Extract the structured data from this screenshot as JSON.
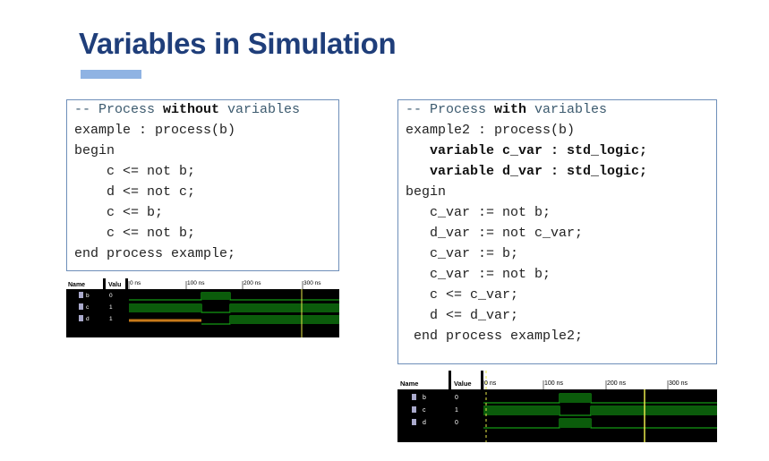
{
  "slide": {
    "title": "Variables in Simulation"
  },
  "left_code": {
    "lines": [
      {
        "pre": "-- Process ",
        "kw": "without",
        "post": " variables",
        "comment": true
      },
      {
        "text": "example : process(b)"
      },
      {
        "text": "begin"
      },
      {
        "text": "    c <= not b;"
      },
      {
        "text": "    d <= not c;"
      },
      {
        "text": "    c <= b;"
      },
      {
        "text": "    c <= not b;"
      },
      {
        "text": "end process example;"
      }
    ]
  },
  "right_code": {
    "lines": [
      {
        "pre": "-- Process ",
        "kw": "with",
        "post": " variables",
        "comment": true
      },
      {
        "text": "example2 : process(b)"
      },
      {
        "text": "   variable c_var : std_logic;",
        "bold": true
      },
      {
        "text": "   variable d_var : std_logic;",
        "bold": true
      },
      {
        "text": "begin"
      },
      {
        "text": "   c_var := not b;"
      },
      {
        "text": "   d_var := not c_var;"
      },
      {
        "text": "   c_var := b;"
      },
      {
        "text": "   c_var := not b;"
      },
      {
        "text": "   c <= c_var;"
      },
      {
        "text": "   d <= d_var;"
      },
      {
        "text": " end process example2;"
      }
    ]
  },
  "wave_left": {
    "headers": {
      "name": "Name",
      "value": "Valu"
    },
    "ticks": [
      "0 ns",
      "100 ns",
      "200 ns",
      "300 ns"
    ],
    "signals": [
      {
        "name": "b",
        "value": "0"
      },
      {
        "name": "c",
        "value": "1"
      },
      {
        "name": "d",
        "value": "1"
      }
    ],
    "colors": {
      "signal": "#18c018",
      "unknown": "#c87a1a",
      "cursor": "#e8e84a"
    }
  },
  "wave_right": {
    "headers": {
      "name": "Name",
      "value": "Value"
    },
    "ticks": [
      "0 ns",
      "100 ns",
      "200 ns",
      "300 ns"
    ],
    "signals": [
      {
        "name": "b",
        "value": "0"
      },
      {
        "name": "c",
        "value": "1"
      },
      {
        "name": "d",
        "value": "0"
      }
    ],
    "colors": {
      "signal": "#18c018",
      "cursor": "#e8e84a"
    }
  }
}
